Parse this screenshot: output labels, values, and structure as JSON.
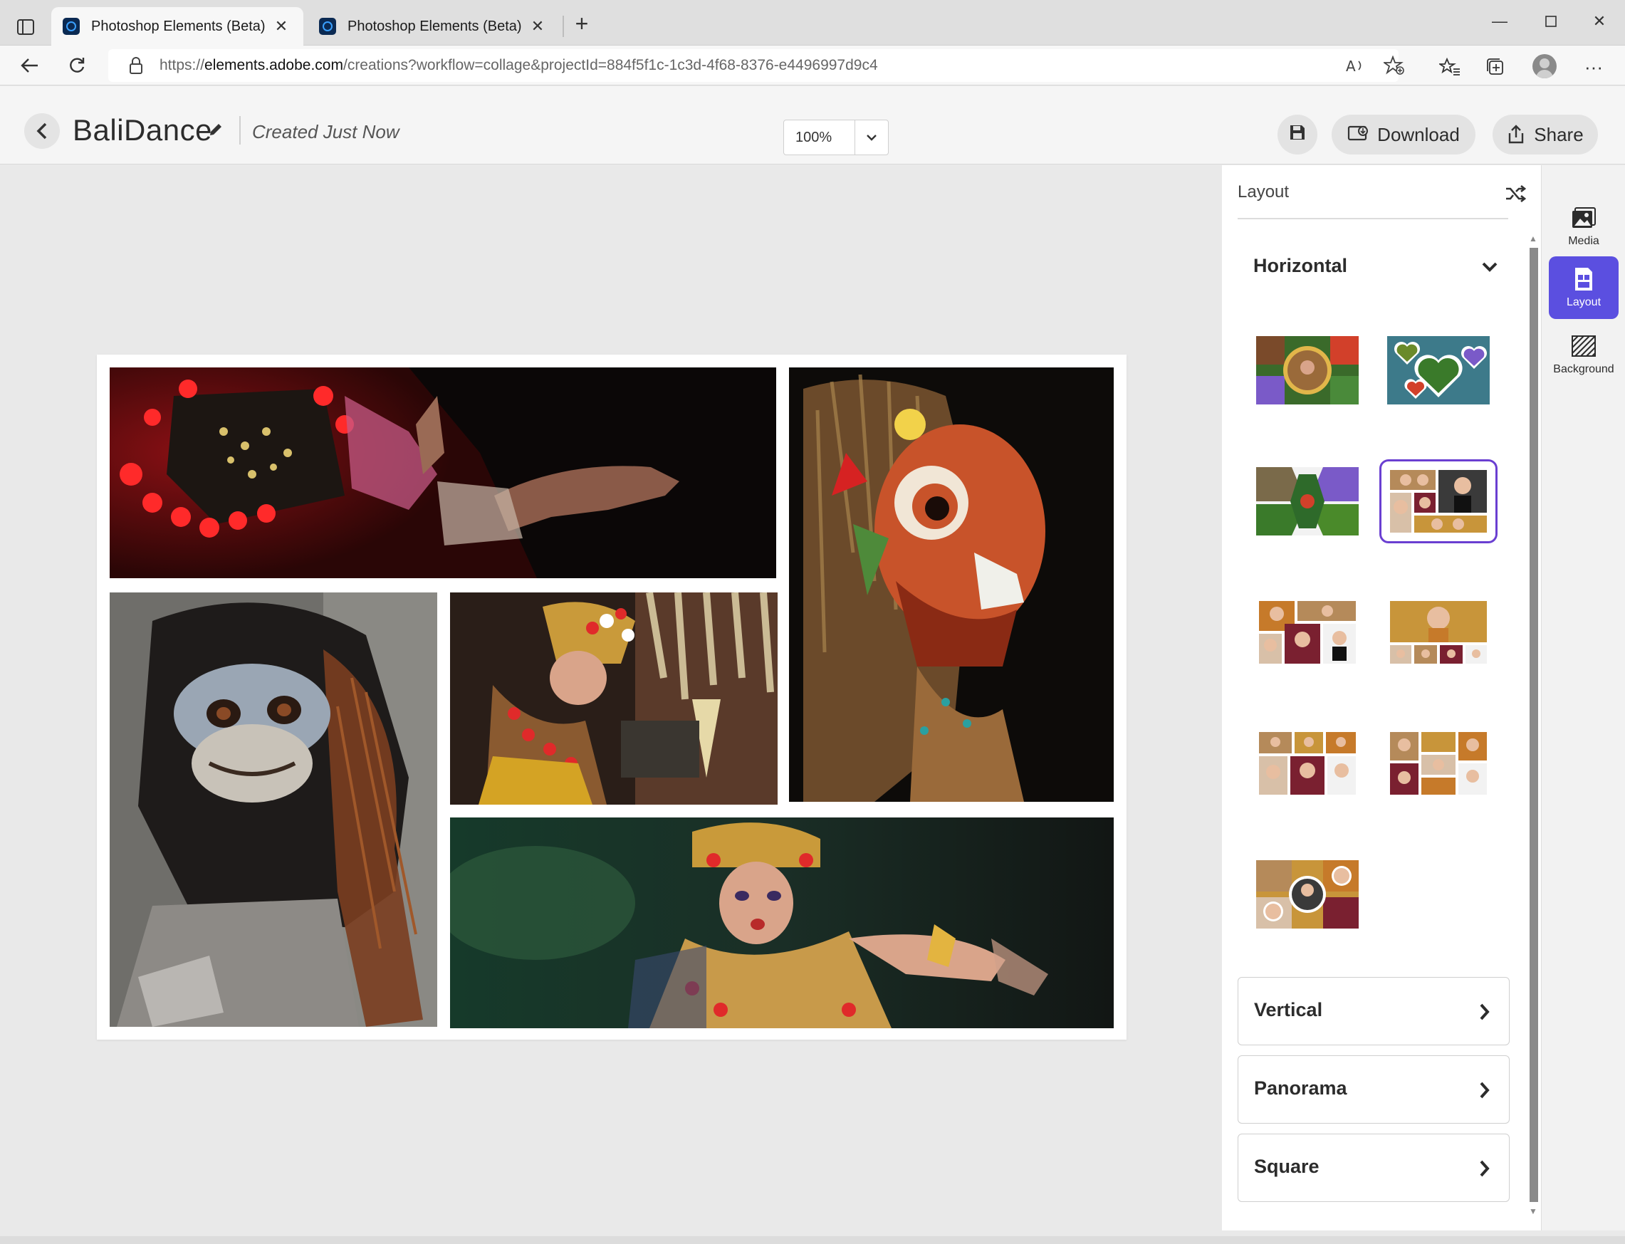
{
  "browser": {
    "tabs": [
      {
        "title": "Photoshop Elements (Beta)",
        "active": true
      },
      {
        "title": "Photoshop Elements (Beta)",
        "active": false
      }
    ],
    "url": {
      "scheme": "https://",
      "host": "elements.adobe.com",
      "path": "/creations?workflow=collage&projectId=884f5f1c-1c3d-4f68-8376-e4496997d9c4"
    },
    "icons": [
      "back-arrow-icon",
      "reload-icon",
      "lock-icon",
      "read-aloud-icon",
      "add-favorite-icon",
      "favorites-icon",
      "collections-icon",
      "profile-icon",
      "more-icon"
    ]
  },
  "header": {
    "project_title": "BaliDance",
    "created_text": "Created Just Now",
    "zoom_value": "100%",
    "download_label": "Download",
    "share_label": "Share"
  },
  "canvas": {
    "photos": [
      "dancer-hands",
      "mask-red-barong",
      "monkey-mask",
      "legong-dancer-side",
      "legong-dancer-front"
    ]
  },
  "panel": {
    "title": "Layout",
    "open_category": "Horizontal",
    "layout_thumbnails": [
      {
        "name": "circle-collage",
        "selected": false
      },
      {
        "name": "heart-collage",
        "selected": false
      },
      {
        "name": "hexagon-collage",
        "selected": false
      },
      {
        "name": "grid-five-photos",
        "selected": true
      },
      {
        "name": "children-grid-1",
        "selected": false
      },
      {
        "name": "children-grid-2",
        "selected": false
      },
      {
        "name": "children-grid-3",
        "selected": false
      },
      {
        "name": "children-grid-4",
        "selected": false
      },
      {
        "name": "children-circles",
        "selected": false
      }
    ],
    "collapsed_categories": [
      "Vertical",
      "Panorama",
      "Square"
    ]
  },
  "rail": {
    "items": [
      {
        "label": "Media",
        "active": false
      },
      {
        "label": "Layout",
        "active": true
      },
      {
        "label": "Background",
        "active": false
      }
    ]
  },
  "colors": {
    "accent": "#5b4fe0",
    "selection": "#6a3fd1",
    "canvas_bg": "#e9e9e9"
  }
}
